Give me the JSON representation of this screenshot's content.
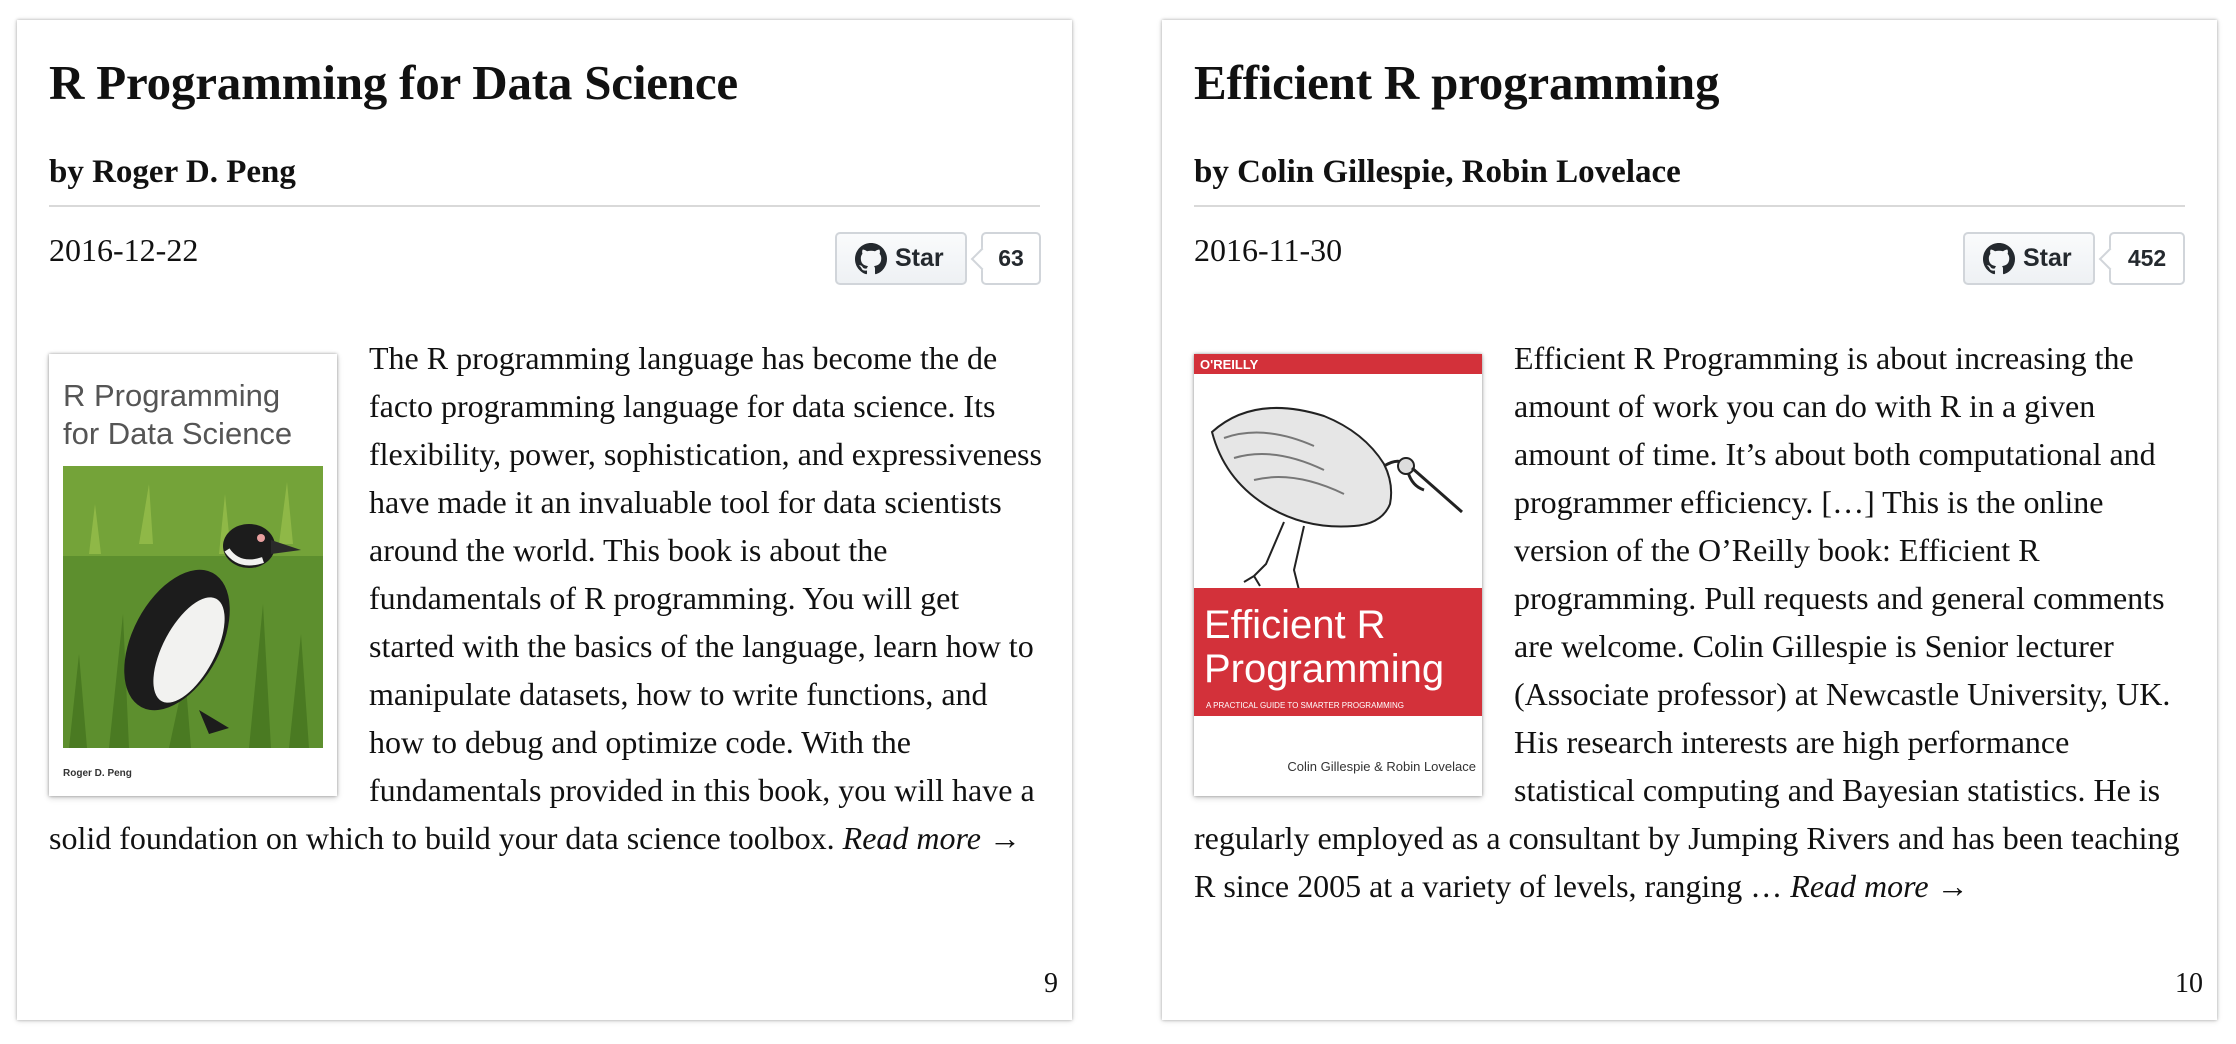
{
  "cards": [
    {
      "title": "R Programming for Data Science",
      "author": "by Roger D. Peng",
      "date": "2016-12-22",
      "star_label": "Star",
      "star_count": "63",
      "cover": {
        "title_line1": "R Programming",
        "title_line2": "for Data Science",
        "author": "Roger D. Peng"
      },
      "description": "The R programming language has become the de facto programming language for data science. Its flexibility, power, sophistication, and expressiveness have made it an invaluable tool for data scientists around the world. This book is about the fundamentals of R programming. You will get started with the basics of the language, learn how to manipulate datasets, how to write functions, and how to debug and optimize code. With the fundamentals provided in this book, you will have a solid foundation on which to build your data science toolbox.",
      "read_more": "Read more →",
      "page_number": "9"
    },
    {
      "title": "Efficient R programming",
      "author": "by Colin Gillespie, Robin Lovelace",
      "date": "2016-11-30",
      "star_label": "Star",
      "star_count": "452",
      "cover": {
        "publisher": "O'REILLY",
        "title_line1": "Efficient R",
        "title_line2": "Programming",
        "subtitle": "A PRACTICAL GUIDE TO SMARTER PROGRAMMING",
        "author": "Colin Gillespie & Robin Lovelace"
      },
      "description": "Efficient R Programming is about increasing the amount of work you can do with R in a given amount of time. It’s about both computational and programmer efficiency. […] This is the online version of the O’Reilly book: Efficient R programming. Pull requests and general comments are welcome. Colin Gillespie is Senior lecturer (Associate professor) at Newcastle University, UK. His research interests are high performance statistical computing and Bayesian statistics. He is regularly employed as a consultant by Jumping Rivers and has been teaching R since 2005 at a variety of levels, ranging …",
      "read_more": "Read more →",
      "page_number": "10"
    }
  ],
  "colors": {
    "oreilly_red": "#d3313a",
    "rule": "#d9d9d9",
    "button_border": "#d1d5da",
    "grass_green": "#5d8f2e"
  },
  "icons": [
    "github-icon"
  ]
}
